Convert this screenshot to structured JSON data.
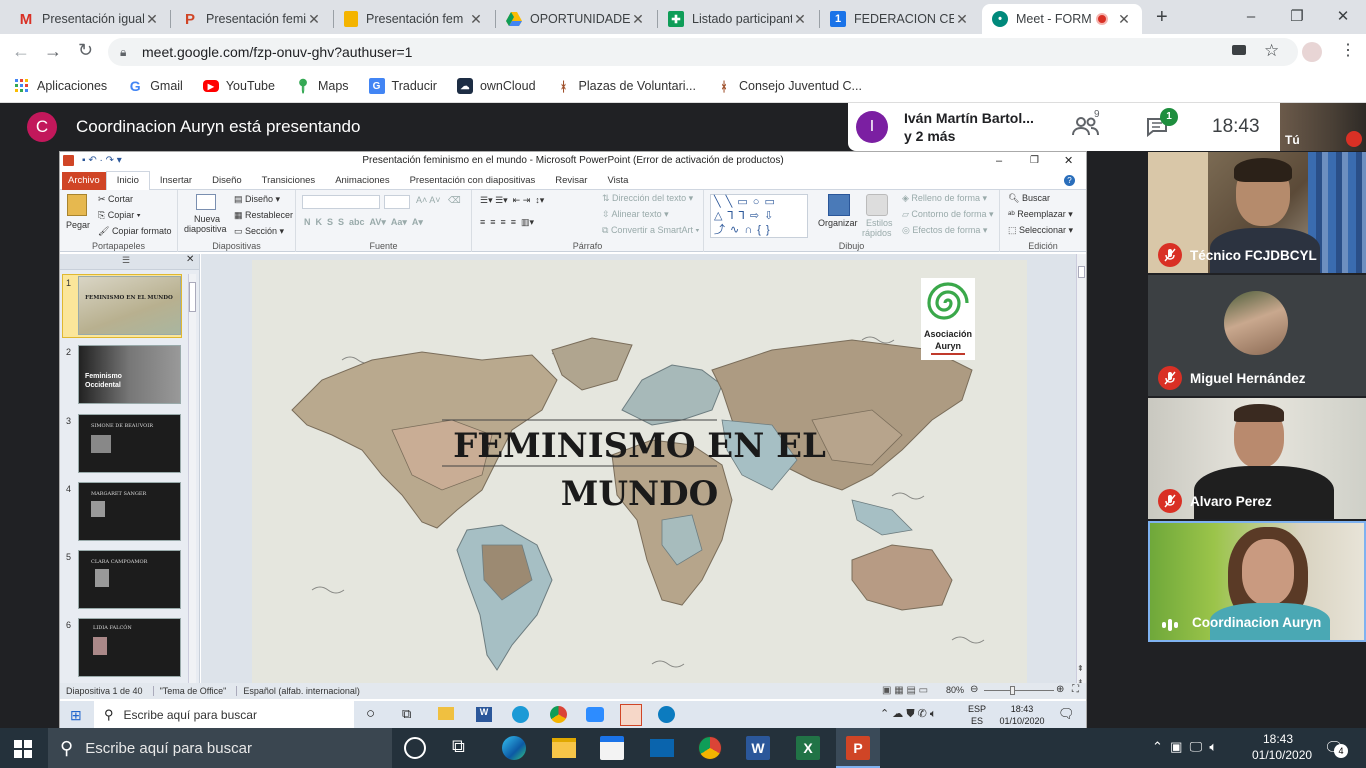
{
  "browser": {
    "tabs": [
      {
        "title": "Presentación igual",
        "favicon": "gmail-icon",
        "color": "#d93025"
      },
      {
        "title": "Presentación femin",
        "favicon": "powerpoint-icon",
        "color": "#d04526"
      },
      {
        "title": "Presentación fem",
        "favicon": "slides-icon",
        "color": "#f4b400"
      },
      {
        "title": "OPORTUNIDADES",
        "favicon": "drive-icon",
        "color": "#0f9d58"
      },
      {
        "title": "Listado participant",
        "favicon": "sheets-icon",
        "color": "#0f9d58"
      },
      {
        "title": "FEDERACION CEN",
        "favicon": "word-icon",
        "color": "#1a73e8"
      },
      {
        "title": "Meet - FORM",
        "favicon": "meet-icon",
        "color": "#00897b"
      }
    ],
    "new_tab": "+",
    "url": "meet.google.com/fzp-onuv-ghv?authuser=1",
    "bookmarks": [
      {
        "label": "Aplicaciones",
        "icon": "apps-grid-icon"
      },
      {
        "label": "Gmail",
        "icon": "google-icon"
      },
      {
        "label": "YouTube",
        "icon": "youtube-icon"
      },
      {
        "label": "Maps",
        "icon": "maps-icon"
      },
      {
        "label": "Traducir",
        "icon": "translate-icon"
      },
      {
        "label": "ownCloud",
        "icon": "owncloud-icon"
      },
      {
        "label": "Plazas de Voluntari...",
        "icon": "ribbon-icon"
      },
      {
        "label": "Consejo Juventud C...",
        "icon": "ribbon-icon"
      }
    ]
  },
  "meet": {
    "presenter_initial": "C",
    "presenter_text": "Coordinacion Auryn está presentando",
    "info_initial": "I",
    "info_line1": "Iván Martín Bartol...",
    "info_line2": "y 2 más",
    "people_count": "9",
    "chat_badge": "1",
    "time": "18:43",
    "self_label": "Tú",
    "participants": [
      {
        "name": "Técnico FCJDBCYL",
        "muted": true
      },
      {
        "name": "Miguel Hernández",
        "muted": true
      },
      {
        "name": "Alvaro Perez",
        "muted": true
      },
      {
        "name": "Coordinacion Auryn",
        "muted": false
      }
    ]
  },
  "ppt": {
    "window_title": "Presentación feminismo en el mundo  -  Microsoft PowerPoint (Error de activación de productos)",
    "menu": [
      "Archivo",
      "Inicio",
      "Insertar",
      "Diseño",
      "Transiciones",
      "Animaciones",
      "Presentación con diapositivas",
      "Revisar",
      "Vista"
    ],
    "ribbon": {
      "paste": "Pegar",
      "cut": "Cortar",
      "copy": "Copiar",
      "format_painter": "Copiar formato",
      "new_slide_1": "Nueva",
      "new_slide_2": "diapositiva",
      "layout": "Diseño",
      "reset": "Restablecer",
      "section": "Sección",
      "text_direction": "Dirección del texto",
      "align_text": "Alinear texto",
      "smartart": "Convertir a SmartArt",
      "arrange": "Organizar",
      "quick_styles_1": "Estilos",
      "quick_styles_2": "rápidos",
      "shape_fill": "Relleno de forma",
      "shape_outline": "Contorno de forma",
      "shape_effects": "Efectos de forma",
      "find": "Buscar",
      "replace": "Reemplazar",
      "select": "Seleccionar",
      "groups": [
        "Portapapeles",
        "Diapositivas",
        "Fuente",
        "Párrafo",
        "Dibujo",
        "Edición"
      ]
    },
    "thumbnails": [
      {
        "num": "1",
        "text": "FEMINISMO EN EL MUNDO"
      },
      {
        "num": "2",
        "text": "Feminismo Occidental"
      },
      {
        "num": "3",
        "text": "SIMONE DE BEAUVOIR"
      },
      {
        "num": "4",
        "text": "MARGARET SANGER"
      },
      {
        "num": "5",
        "text": "CLARA CAMPOAMOR"
      },
      {
        "num": "6",
        "text": "LIDIA FALCÓN"
      }
    ],
    "slide": {
      "title_line1": "FEMINISMO EN EL",
      "title_line2": "MUNDO",
      "logo_text_1": "Asociación",
      "logo_text_2": "Auryn"
    },
    "status": {
      "slide_count": "Diapositiva 1 de 40",
      "theme": "\"Tema de Office\"",
      "language": "Español (alfab. internacional)",
      "zoom": "80%"
    },
    "inner_taskbar": {
      "search_placeholder": "Escribe aquí para buscar",
      "lang_1": "ESP",
      "lang_2": "ES",
      "time": "18:43",
      "date": "01/10/2020"
    }
  },
  "taskbar": {
    "search_placeholder": "Escribe aquí para buscar",
    "time": "18:43",
    "date": "01/10/2020",
    "notification_count": "4"
  }
}
